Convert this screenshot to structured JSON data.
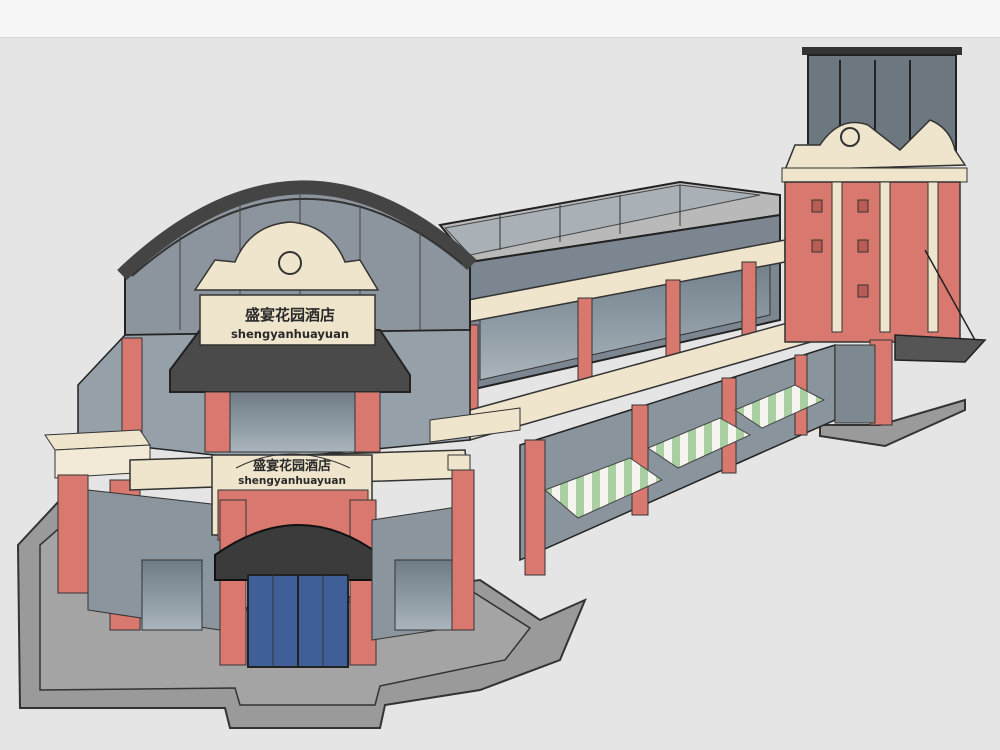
{
  "signs": {
    "upper_cn": "盛宴花园酒店",
    "upper_en": "shengyanhuayuan",
    "lower_cn": "盛宴花园酒店",
    "lower_en": "shengyanhuayuan"
  },
  "colors": {
    "viewport_bg": "#e5e5e5",
    "toolbar_bg": "#f6f6f6",
    "brick": "#d9786f",
    "cream": "#efe4cc",
    "dark_roof": "#4a4a4a",
    "glass": "#8c9aa6",
    "awning_green": "#9fc79a"
  },
  "icons": {
    "window_bar": "toolbar-strip"
  }
}
